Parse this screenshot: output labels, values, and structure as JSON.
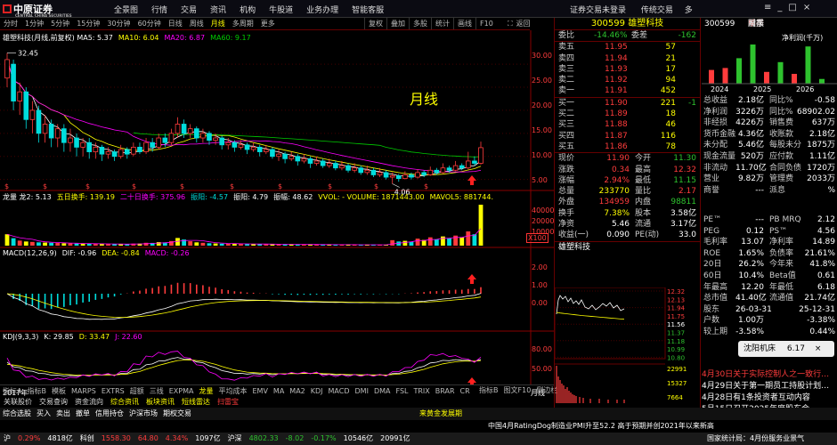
{
  "app": {
    "logo": "中原证券",
    "logo_sub": "CENTRAL CHINA SECURITIES",
    "menu": [
      "全景图",
      "行情",
      "交易",
      "资讯",
      "机构",
      "牛股道",
      "业务办理",
      "智能客服"
    ],
    "status_right": [
      "证券交易未登录",
      "传统交易"
    ],
    "menu_more": "多"
  },
  "period_tabs": [
    "分时",
    "1分钟",
    "5分钟",
    "15分钟",
    "30分钟",
    "60分钟",
    "日线",
    "周线",
    "月线",
    "多周期",
    "更多"
  ],
  "active_tab": "月线",
  "toolbar": [
    "复权",
    "叠加",
    "多股",
    "统计",
    "画线",
    "F10"
  ],
  "toolbar_right": "返回",
  "chart": {
    "stock_label": "雄塑科技(月线,前复权)",
    "ma_legend": [
      {
        "t": "MA5: 5.37",
        "c": "#fff"
      },
      {
        "t": "MA10: 6.04",
        "c": "#ff0"
      },
      {
        "t": "MA20: 6.87",
        "c": "#f0f"
      },
      {
        "t": "MA60: 9.17",
        "c": "#0c0"
      }
    ],
    "title_watermark": "月线",
    "high_label": "32.45",
    "low_label": "4.06",
    "yticks": [
      "30.00",
      "25.00",
      "20.00",
      "15.00",
      "10.00",
      "5.00"
    ],
    "vol_legend": [
      {
        "t": "龙量 龙2: 5.13",
        "c": "#fff"
      },
      {
        "t": "五日换手: 139.19",
        "c": "#ff0"
      },
      {
        "t": "二十日换手: 375.96",
        "c": "#f0f"
      },
      {
        "t": "振阳: -4.57",
        "c": "#0dd"
      },
      {
        "t": "振阳: 4.79",
        "c": "#fff"
      },
      {
        "t": "振幅: 48.62",
        "c": "#fff"
      },
      {
        "t": "VVOL: - VOLUME: 1871443.00",
        "c": "#ff0"
      },
      {
        "t": "MAVOL5: 881744.",
        "c": "#ff0"
      }
    ],
    "vol_ticks": [
      "40000",
      "20000",
      "10000"
    ],
    "vol_unit": "X100",
    "macd_legend": [
      {
        "t": "MACD(12,26,9)",
        "c": "#fff"
      },
      {
        "t": "DIF: -0.96",
        "c": "#fff"
      },
      {
        "t": "DEA: -0.84",
        "c": "#ff0"
      },
      {
        "t": "MACD: -0.26",
        "c": "#f0f"
      }
    ],
    "macd_ticks": [
      "2.00",
      "1.00",
      "0.00"
    ],
    "kdj_legend": [
      {
        "t": "KDJ(9,3,3)",
        "c": "#fff"
      },
      {
        "t": "K: 29.85",
        "c": "#fff"
      },
      {
        "t": "D: 33.47",
        "c": "#ff0"
      },
      {
        "t": "J: 22.60",
        "c": "#f0f"
      }
    ],
    "kdj_ticks": [
      "80.00",
      "50.00"
    ],
    "year_label": "2017年",
    "period_label": "月线",
    "candles": [
      {
        "o": 27,
        "c": 31,
        "h": 32.45,
        "l": 25
      },
      {
        "o": 30,
        "c": 22,
        "h": 31,
        "l": 20
      },
      {
        "o": 22,
        "c": 24,
        "h": 26,
        "l": 19
      },
      {
        "o": 24,
        "c": 18,
        "h": 25,
        "l": 16
      },
      {
        "o": 18,
        "c": 20,
        "h": 22,
        "l": 15
      },
      {
        "o": 20,
        "c": 15,
        "h": 21,
        "l": 13
      },
      {
        "o": 15,
        "c": 17,
        "h": 19,
        "l": 13
      },
      {
        "o": 17,
        "c": 14,
        "h": 18,
        "l": 12
      },
      {
        "o": 14,
        "c": 16,
        "h": 17,
        "l": 12
      },
      {
        "o": 16,
        "c": 13,
        "h": 17,
        "l": 11
      },
      {
        "o": 13,
        "c": 14,
        "h": 16,
        "l": 11
      },
      {
        "o": 14,
        "c": 12,
        "h": 15,
        "l": 10
      },
      {
        "o": 12,
        "c": 13,
        "h": 14,
        "l": 10
      },
      {
        "o": 13,
        "c": 11,
        "h": 14,
        "l": 9.5
      },
      {
        "o": 11,
        "c": 12,
        "h": 13,
        "l": 9.5
      },
      {
        "o": 12,
        "c": 10.5,
        "h": 12.5,
        "l": 9
      },
      {
        "o": 10.5,
        "c": 11,
        "h": 12,
        "l": 9.5
      },
      {
        "o": 11,
        "c": 10,
        "h": 11.5,
        "l": 9
      },
      {
        "o": 10,
        "c": 11.5,
        "h": 12.5,
        "l": 9.5
      },
      {
        "o": 11.5,
        "c": 10.5,
        "h": 12,
        "l": 9.5
      },
      {
        "o": 10.5,
        "c": 12,
        "h": 13,
        "l": 10
      },
      {
        "o": 12,
        "c": 11,
        "h": 13,
        "l": 10.5
      },
      {
        "o": 11,
        "c": 13,
        "h": 14,
        "l": 10.5
      },
      {
        "o": 13,
        "c": 12,
        "h": 14,
        "l": 11
      },
      {
        "o": 12,
        "c": 14,
        "h": 15,
        "l": 11.5
      },
      {
        "o": 14,
        "c": 13,
        "h": 15,
        "l": 12
      },
      {
        "o": 13,
        "c": 15,
        "h": 16,
        "l": 12.5
      },
      {
        "o": 15,
        "c": 17,
        "h": 18.5,
        "l": 14
      },
      {
        "o": 17,
        "c": 15,
        "h": 18,
        "l": 14
      },
      {
        "o": 15,
        "c": 16,
        "h": 17,
        "l": 14
      },
      {
        "o": 16,
        "c": 14,
        "h": 16.5,
        "l": 13
      },
      {
        "o": 14,
        "c": 15,
        "h": 16,
        "l": 13
      },
      {
        "o": 15,
        "c": 13.5,
        "h": 15.5,
        "l": 12.5
      },
      {
        "o": 13.5,
        "c": 14,
        "h": 15,
        "l": 12.5
      },
      {
        "o": 14,
        "c": 12.5,
        "h": 14.5,
        "l": 11.5
      },
      {
        "o": 12.5,
        "c": 13,
        "h": 14,
        "l": 11.5
      },
      {
        "o": 13,
        "c": 12,
        "h": 13.5,
        "l": 11
      },
      {
        "o": 12,
        "c": 12.5,
        "h": 13.5,
        "l": 11.5
      },
      {
        "o": 12.5,
        "c": 11.5,
        "h": 13,
        "l": 10.5
      },
      {
        "o": 11.5,
        "c": 12,
        "h": 13,
        "l": 11
      },
      {
        "o": 12,
        "c": 11,
        "h": 12.5,
        "l": 10
      },
      {
        "o": 11,
        "c": 11.5,
        "h": 12.5,
        "l": 10.5
      },
      {
        "o": 11.5,
        "c": 10,
        "h": 12,
        "l": 9.5
      },
      {
        "o": 10,
        "c": 10.5,
        "h": 11.5,
        "l": 9
      },
      {
        "o": 10.5,
        "c": 9.5,
        "h": 11,
        "l": 8.5
      },
      {
        "o": 9.5,
        "c": 10,
        "h": 11,
        "l": 9
      },
      {
        "o": 10,
        "c": 9,
        "h": 10.5,
        "l": 8
      },
      {
        "o": 9,
        "c": 9.5,
        "h": 10.5,
        "l": 8.5
      },
      {
        "o": 9.5,
        "c": 8.5,
        "h": 10,
        "l": 7.5
      },
      {
        "o": 8.5,
        "c": 9,
        "h": 10,
        "l": 8
      },
      {
        "o": 9,
        "c": 8,
        "h": 9.5,
        "l": 7.5
      },
      {
        "o": 8,
        "c": 8.5,
        "h": 9.5,
        "l": 7.5
      },
      {
        "o": 8.5,
        "c": 7.5,
        "h": 9,
        "l": 7
      },
      {
        "o": 7.5,
        "c": 8,
        "h": 9,
        "l": 7
      },
      {
        "o": 8,
        "c": 7,
        "h": 8.5,
        "l": 6.5
      },
      {
        "o": 7,
        "c": 7.5,
        "h": 8.5,
        "l": 6.5
      },
      {
        "o": 7.5,
        "c": 6.5,
        "h": 8,
        "l": 6
      },
      {
        "o": 6.5,
        "c": 7,
        "h": 8,
        "l": 6
      },
      {
        "o": 7,
        "c": 6,
        "h": 7.5,
        "l": 5.5
      },
      {
        "o": 6,
        "c": 6.5,
        "h": 7.5,
        "l": 5.5
      },
      {
        "o": 6.5,
        "c": 5.5,
        "h": 7,
        "l": 5
      },
      {
        "o": 5.5,
        "c": 5.8,
        "h": 6.5,
        "l": 4.06
      },
      {
        "o": 5.8,
        "c": 5.2,
        "h": 6.2,
        "l": 4.5
      },
      {
        "o": 5.2,
        "c": 6,
        "h": 6.8,
        "l": 5
      },
      {
        "o": 6,
        "c": 5.5,
        "h": 6.5,
        "l": 5
      },
      {
        "o": 5.5,
        "c": 6.5,
        "h": 7.2,
        "l": 5.2
      },
      {
        "o": 6.5,
        "c": 6,
        "h": 7,
        "l": 5.5
      },
      {
        "o": 6,
        "c": 7,
        "h": 7.8,
        "l": 5.8
      },
      {
        "o": 7,
        "c": 6.5,
        "h": 7.5,
        "l": 6
      },
      {
        "o": 6.5,
        "c": 7.5,
        "h": 8.5,
        "l": 6.2
      },
      {
        "o": 7.5,
        "c": 7,
        "h": 8,
        "l": 6.5
      },
      {
        "o": 7,
        "c": 8,
        "h": 9,
        "l": 6.8
      },
      {
        "o": 8,
        "c": 7.5,
        "h": 8.5,
        "l": 7
      },
      {
        "o": 7.5,
        "c": 9,
        "h": 11,
        "l": 7.2
      },
      {
        "o": 9,
        "c": 8.5,
        "h": 10,
        "l": 8
      },
      {
        "o": 8.5,
        "c": 11.9,
        "h": 13.2,
        "l": 8.2
      }
    ],
    "volumes": [
      5200,
      3400,
      2300,
      1900,
      1700,
      1500,
      1400,
      1300,
      1200,
      1100,
      1000,
      950,
      900,
      850,
      800,
      760,
      720,
      700,
      680,
      650,
      900,
      950,
      1300,
      1250,
      1600,
      1500,
      2100,
      3500,
      2800,
      2000,
      1500,
      1300,
      1100,
      1000,
      900,
      850,
      800,
      780,
      750,
      720,
      680,
      650,
      620,
      600,
      580,
      560,
      540,
      520,
      500,
      480,
      460,
      450,
      440,
      430,
      420,
      410,
      400,
      390,
      380,
      370,
      360,
      2500,
      1900,
      2200,
      1800,
      3200,
      2600,
      3800,
      2900,
      4200,
      3300,
      4600,
      3800,
      6500,
      5200,
      18714
    ]
  },
  "quote": {
    "code": "300599",
    "name": "雄塑科技",
    "weibi_label": "委比",
    "weibi": "-14.46%",
    "weicha_label": "委差",
    "weicha": "-162",
    "sells": [
      {
        "n": "卖五",
        "p": "11.95",
        "v": "57"
      },
      {
        "n": "卖四",
        "p": "11.94",
        "v": "21"
      },
      {
        "n": "卖三",
        "p": "11.93",
        "v": "17"
      },
      {
        "n": "卖二",
        "p": "11.92",
        "v": "94"
      },
      {
        "n": "卖一",
        "p": "11.91",
        "v": "452"
      }
    ],
    "buys": [
      {
        "n": "买一",
        "p": "11.90",
        "v": "221",
        "x": "-1"
      },
      {
        "n": "买二",
        "p": "11.89",
        "v": "18"
      },
      {
        "n": "买三",
        "p": "11.88",
        "v": "46"
      },
      {
        "n": "买四",
        "p": "11.87",
        "v": "116"
      },
      {
        "n": "买五",
        "p": "11.86",
        "v": "78"
      }
    ],
    "stats": [
      [
        {
          "l": "现价",
          "v": "11.90",
          "c": "#ff3c3c"
        },
        {
          "l": "今开",
          "v": "11.30",
          "c": "#2ec22e"
        }
      ],
      [
        {
          "l": "涨跌",
          "v": "0.34",
          "c": "#ff3c3c"
        },
        {
          "l": "最高",
          "v": "12.32",
          "c": "#ff3c3c"
        }
      ],
      [
        {
          "l": "涨幅",
          "v": "2.94%",
          "c": "#ff3c3c"
        },
        {
          "l": "最低",
          "v": "11.15",
          "c": "#2ec22e"
        }
      ],
      [
        {
          "l": "总量",
          "v": "233770",
          "c": "#ff0"
        },
        {
          "l": "量比",
          "v": "2.17",
          "c": "#ff3c3c"
        }
      ],
      [
        {
          "l": "外盘",
          "v": "134959",
          "c": "#ff3c3c"
        },
        {
          "l": "内盘",
          "v": "98811",
          "c": "#2ec22e"
        }
      ],
      [
        {
          "l": "换手",
          "v": "7.38%",
          "c": "#ff0"
        },
        {
          "l": "股本",
          "v": "3.58亿",
          "c": "#fff"
        }
      ],
      [
        {
          "l": "净资",
          "v": "5.46",
          "c": "#fff"
        },
        {
          "l": "流通",
          "v": "3.17亿",
          "c": "#fff"
        }
      ],
      [
        {
          "l": "收益(一)",
          "v": "0.090",
          "c": "#fff"
        },
        {
          "l": "PE(动)",
          "v": "33.0",
          "c": "#fff"
        }
      ]
    ],
    "mini_name": "雄塑科技",
    "mini_ticks": [
      {
        "t": "12.32",
        "c": "#ff3c3c"
      },
      {
        "t": "12.13",
        "c": "#ff3c3c"
      },
      {
        "t": "11.94",
        "c": "#ff3c3c"
      },
      {
        "t": "11.75",
        "c": "#ff3c3c"
      },
      {
        "t": "11.56",
        "c": "#fff"
      },
      {
        "t": "11.37",
        "c": "#2ec22e"
      },
      {
        "t": "11.18",
        "c": "#2ec22e"
      },
      {
        "t": "10.99",
        "c": "#2ec22e"
      },
      {
        "t": "10.80",
        "c": "#2ec22e"
      }
    ],
    "mini_pct": [
      {
        "t": "6.58%",
        "c": "#ff3c3c"
      },
      {
        "t": "4.93%",
        "c": "#ff3c3c"
      },
      {
        "t": "3.29%",
        "c": "#ff3c3c"
      },
      {
        "t": "1.64%",
        "c": "#ff3c3c"
      },
      {
        "t": "0.00%",
        "c": "#fff"
      },
      {
        "t": "1.64%",
        "c": "#2ec22e"
      },
      {
        "t": "3.29%",
        "c": "#2ec22e"
      },
      {
        "t": "4.93%",
        "c": "#2ec22e"
      },
      {
        "t": "6.58%",
        "c": "#2ec22e"
      }
    ],
    "mini_vol": [
      "22991",
      "15327",
      "7664"
    ],
    "mini_tabs": [
      "笔",
      "价",
      "细",
      "势",
      "联",
      "值",
      "主",
      "筹"
    ],
    "mini_act": "势"
  },
  "fund": {
    "code": "300599",
    "tabs": [
      "单季",
      "同季",
      "财报",
      "股东"
    ],
    "act": "单季",
    "chart_title": "净利润(千万)",
    "years": [
      "2024",
      "2025",
      "2026"
    ],
    "bars": [
      {
        "v": 0.35,
        "c": "#ff3c3c"
      },
      {
        "v": 0.4,
        "c": "#ff3c3c"
      },
      {
        "v": 0.65,
        "c": "#2ec22e"
      },
      {
        "v": 1.0,
        "c": "#2ec22e"
      },
      {
        "v": 0.3,
        "c": "#ff3c3c"
      },
      {
        "v": 0.55,
        "c": "#2ec22e"
      },
      {
        "v": 0.25,
        "c": "#ff3c3c"
      },
      {
        "v": 0.95,
        "c": "#2ec22e"
      },
      {
        "v": 0.12,
        "c": "#2ec22e"
      }
    ],
    "rows": [
      [
        {
          "l": "总收益",
          "v": "2.18亿"
        },
        {
          "l": "同比%",
          "v": "-0.58"
        }
      ],
      [
        {
          "l": "净利润",
          "v": "3226万"
        },
        {
          "l": "同比%",
          "v": "68902.02"
        }
      ],
      [
        {
          "l": "非经损",
          "v": "4226万"
        },
        {
          "l": "销售费",
          "v": "637万"
        }
      ],
      [
        {
          "l": "货币金融",
          "v": "4.36亿"
        },
        {
          "l": "收账款",
          "v": "2.18亿"
        }
      ],
      [
        {
          "l": "未分配",
          "v": "5.46亿"
        },
        {
          "l": "每股未分",
          "v": "1875万"
        }
      ],
      [
        {
          "l": "现金流量",
          "v": "520万"
        },
        {
          "l": "应付款",
          "v": "1.11亿"
        }
      ],
      [
        {
          "l": "非流动",
          "v": "11.70亿"
        },
        {
          "l": "合同负债",
          "v": "1720万"
        }
      ],
      [
        {
          "l": "营业",
          "v": "9.82万"
        },
        {
          "l": "管理费",
          "v": "2033万"
        }
      ],
      [
        {
          "l": "商誉",
          "v": "---"
        },
        {
          "l": "派息",
          "v": "%"
        }
      ]
    ],
    "rows2": [
      [
        {
          "l": "PE™",
          "v": "---"
        },
        {
          "l": "PB MRQ",
          "v": "2.12"
        }
      ],
      [
        {
          "l": "PEG",
          "v": "0.12"
        },
        {
          "l": "PS™",
          "v": "4.56"
        }
      ],
      [
        {
          "l": "毛利率",
          "v": "13.07"
        },
        {
          "l": "净利率",
          "v": "14.89"
        }
      ],
      [
        {
          "l": "ROE",
          "v": "1.65%"
        },
        {
          "l": "负债率",
          "v": "21.61%"
        }
      ],
      [
        {
          "l": "20日",
          "v": "26.2%"
        },
        {
          "l": "今年来",
          "v": "41.8%"
        }
      ],
      [
        {
          "l": "60日",
          "v": "10.4%"
        },
        {
          "l": "Beta值",
          "v": "0.61"
        }
      ],
      [
        {
          "l": "年最高",
          "v": "12.20"
        },
        {
          "l": "年最低",
          "v": "6.18"
        }
      ],
      [
        {
          "l": "总市值",
          "v": "41.40亿"
        },
        {
          "l": "流通值",
          "v": "21.74亿"
        }
      ],
      [
        {
          "l": "股东",
          "v": "26-03-31"
        },
        {
          "l": "",
          "v": "25-12-31"
        }
      ],
      [
        {
          "l": "户数",
          "v": "1.00万"
        },
        {
          "l": "",
          "v": "-3.38%"
        }
      ],
      [
        {
          "l": "较上期",
          "v": "-3.58%"
        },
        {
          "l": "",
          "v": "0.44%"
        }
      ]
    ],
    "popup_name": "沈阳机床",
    "popup_val": "6.17",
    "news": [
      "4月30日关于实际控制人之一致行…",
      "4月29日关于第一期员工持股计划…",
      "4月28日有1条投资者互动内容",
      "5月15日召开2025年度股东会"
    ]
  },
  "bottom_tabs": [
    "指标A",
    "指标B",
    "模板",
    "MARPS",
    "EXTRS",
    "超额",
    "三线",
    "EXPMA",
    "龙量",
    "平均成本",
    "EMV",
    "MA",
    "MA2",
    "KDJ",
    "MACD",
    "DMI",
    "DMA",
    "FSL",
    "TRIX",
    "BRAR",
    "CR"
  ],
  "bottom_tabs_right": [
    "指标B",
    "图文F10",
    "侧边栏"
  ],
  "bottombar": [
    "关联股价",
    "交易查询",
    "资金流向",
    "综合资讯",
    "板块资讯",
    "短线雷达",
    "扫雷宝"
  ],
  "bottombar_right": "来黄金发展期",
  "status": [
    {
      "t": "综合选股",
      "c": "#fff"
    },
    {
      "t": "买入",
      "c": "#fff"
    },
    {
      "t": "卖出",
      "c": "#fff"
    },
    {
      "t": "撤单",
      "c": "#fff"
    },
    {
      "t": "信用持仓",
      "c": "#fff"
    },
    {
      "t": "沪深市场",
      "c": "#fff"
    },
    {
      "t": "期权交易",
      "c": "#fff"
    }
  ],
  "news_ticker": "中国4月RatingDog制造业PMI升至52.2 高于预期并创2021年以来新高",
  "taskbar": [
    {
      "t": "沪",
      "c": "#fff"
    },
    {
      "t": "0.29%",
      "c": "#ff3c3c"
    },
    {
      "t": "4818亿",
      "c": "#fff"
    },
    {
      "t": "科创",
      "c": "#fff"
    },
    {
      "t": "1558.30",
      "c": "#ff3c3c"
    },
    {
      "t": "64.80",
      "c": "#ff3c3c"
    },
    {
      "t": "4.34%",
      "c": "#ff3c3c"
    },
    {
      "t": "1097亿",
      "c": "#fff"
    },
    {
      "t": "沪深",
      "c": "#fff"
    },
    {
      "t": "4802.33",
      "c": "#2ec22e"
    },
    {
      "t": "-8.02",
      "c": "#2ec22e"
    },
    {
      "t": "-0.17%",
      "c": "#2ec22e"
    },
    {
      "t": "10546亿",
      "c": "#fff"
    },
    {
      "t": "20991亿",
      "c": "#fff"
    }
  ],
  "taskbar_right": "国家统计局：4月份服务业景气"
}
